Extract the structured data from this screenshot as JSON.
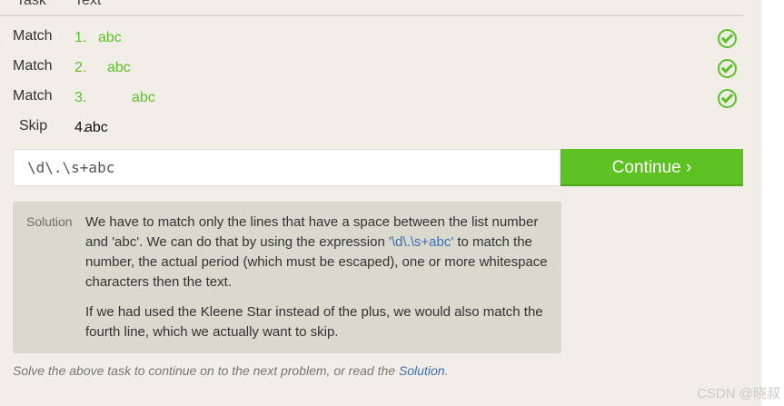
{
  "header": {
    "col_task": "Task",
    "col_text": "Text"
  },
  "rows": [
    {
      "task": "Match",
      "num": "1.",
      "text": "abc",
      "status": "matched"
    },
    {
      "task": "Match",
      "num": "2.",
      "text": "abc",
      "status": "matched"
    },
    {
      "task": "Match",
      "num": "3.",
      "text": "abc",
      "status": "matched"
    },
    {
      "task": "Skip",
      "num": "4.",
      "text": "abc",
      "status": "skipped"
    }
  ],
  "input": {
    "value": "\\d\\.\\s+abc"
  },
  "continue_label": "Continue ›",
  "solution": {
    "label": "Solution",
    "p1_before": "We have to match only the lines that have a space between the list number and 'abc'. We can do that by using the expression ",
    "p1_expr": "'\\d\\.\\s+abc'",
    "p1_after": " to match the number, the actual period (which must be escaped), one or more whitespace characters then the text.",
    "p2": "If we had used the Kleene Star instead of the plus, we would also match the fourth line, which we actually want to skip."
  },
  "footer": {
    "text": "Solve the above task to continue on to the next problem, or read the ",
    "link": "Solution",
    "end": "."
  },
  "watermark": "CSDN @晓叔",
  "colors": {
    "accent_green": "#5cc121",
    "link_blue": "#3a6fb5",
    "panel_bg": "#f0eee6",
    "solution_bg": "#d9d9cd"
  },
  "icons": {
    "row_status": "check-circle-icon"
  }
}
